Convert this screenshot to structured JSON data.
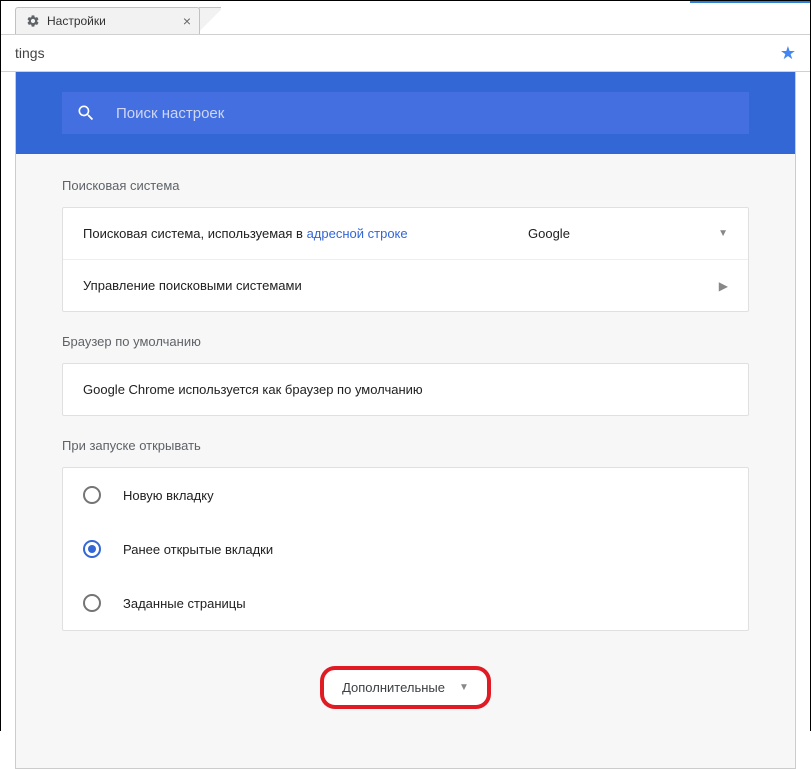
{
  "tab": {
    "title": "Настройки"
  },
  "address": {
    "url_fragment": "tings"
  },
  "search": {
    "placeholder": "Поиск настроек"
  },
  "sections": {
    "search_engine": {
      "title": "Поисковая система",
      "row_label_prefix": "Поисковая система, используемая в ",
      "row_label_link": "адресной строке",
      "selected_engine": "Google",
      "manage_label": "Управление поисковыми системами"
    },
    "default_browser": {
      "title": "Браузер по умолчанию",
      "status": "Google Chrome используется как браузер по умолчанию"
    },
    "on_startup": {
      "title": "При запуске открывать",
      "options": [
        {
          "label": "Новую вкладку",
          "checked": false
        },
        {
          "label": "Ранее открытые вкладки",
          "checked": true
        },
        {
          "label": "Заданные страницы",
          "checked": false
        }
      ]
    }
  },
  "advanced": {
    "label": "Дополнительные"
  }
}
